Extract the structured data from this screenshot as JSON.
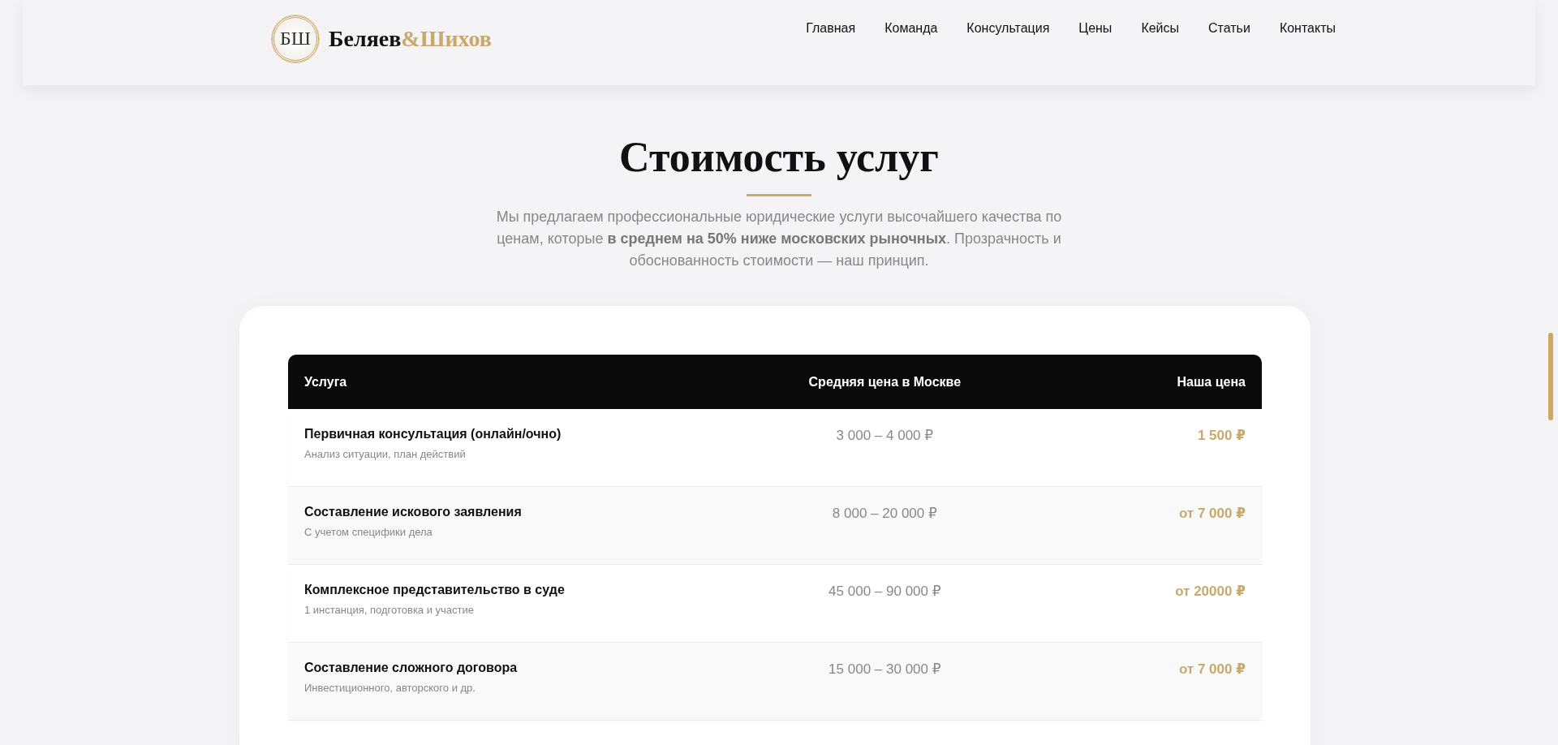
{
  "header": {
    "logo": {
      "monogram": "БШ",
      "name_primary": "Беляев",
      "name_secondary": "&Шихов"
    },
    "nav": [
      {
        "label": "Главная"
      },
      {
        "label": "Команда"
      },
      {
        "label": "Консультация"
      },
      {
        "label": "Цены"
      },
      {
        "label": "Кейсы"
      },
      {
        "label": "Статьи"
      },
      {
        "label": "Контакты"
      }
    ]
  },
  "section": {
    "title": "Стоимость услуг",
    "subtitle": "Мы предлагаем профессиональные юридические услуги высочайшего качества по ценам, которые **в среднем на 50% ниже московских рыночных**. Прозрачность и обоснованность стоимости — наш принцип."
  },
  "table": {
    "columns": [
      "Услуга",
      "Средняя цена в Москве",
      "Наша цена"
    ],
    "rows": [
      {
        "service": "Первичная консультация (онлайн/очно)",
        "note": "Анализ ситуации, план действий",
        "market_price": "3 000 – 4 000 ₽",
        "our_price": "1 500 ₽"
      },
      {
        "service": "Составление искового заявления",
        "note": "С учетом специфики дела",
        "market_price": "8 000 – 20 000 ₽",
        "our_price": "от 7 000 ₽"
      },
      {
        "service": "Комплексное представительство в суде",
        "note": "1 инстанция, подготовка и участие",
        "market_price": "45 000 – 90 000 ₽",
        "our_price": "от 20000 ₽"
      },
      {
        "service": "Составление сложного договора",
        "note": "Инвестиционного, авторского и др.",
        "market_price": "15 000 – 30 000 ₽",
        "our_price": "от 7 000 ₽"
      }
    ]
  }
}
